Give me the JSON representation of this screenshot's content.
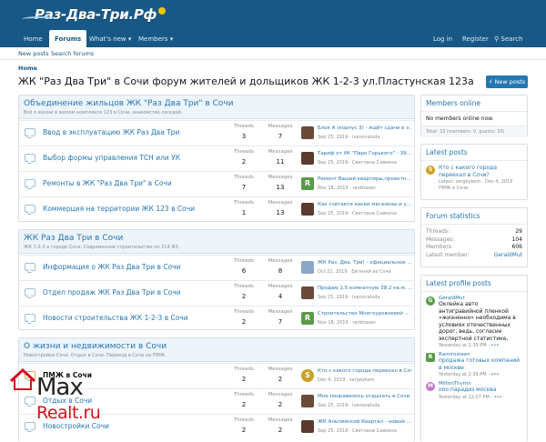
{
  "site": {
    "logo_text": "Раз-Два-Три.Рф"
  },
  "nav": {
    "home": "Home",
    "forums": "Forums",
    "whats_new": "What's new",
    "members": "Members",
    "login": "Log in",
    "register": "Register",
    "search": "Search"
  },
  "subnav": {
    "new_posts": "New posts",
    "search_forums": "Search forums"
  },
  "breadcrumb": "Home",
  "page_title": "ЖК \"Раз Два Три\" в Сочи форум жителей и дольщиков ЖК 1-2-3 ул.Пластунская 123а",
  "new_posts_button": "New posts",
  "stat_labels": {
    "threads": "Threads",
    "messages": "Messages"
  },
  "categories": [
    {
      "title": "Объединение жильцов ЖК \"Раз Два Три\" в Сочи",
      "desc": "Всё о жизни в жилом комплексе 123 в Сочи, знакомство соседей.",
      "forums": [
        {
          "name": "Ввод в эксплуатацию ЖК Раз Два Три",
          "threads": "3",
          "messages": "7",
          "last_title": "Блок А (корпус 3) - ждёт сдачи в э...",
          "last_meta": "Sep 25, 2019 · ivanovaluda",
          "avatar_letter": "",
          "avatar_color": "#6b4a3a"
        },
        {
          "name": "Выбор формы управления ТСН или УК",
          "threads": "2",
          "messages": "11",
          "last_title": "Тариф от УК \"Парк Горького\" - 39...",
          "last_meta": "Sep 25, 2019 · Светлана Савкина",
          "avatar_letter": "",
          "avatar_color": "#5a3a2e"
        },
        {
          "name": "Ремонты в ЖК \"Раз Два Три\" в Сочи",
          "threads": "7",
          "messages": "13",
          "last_title": "Ремонт Вашей квартиры,проектн...",
          "last_meta": "Nov 18, 2019 · rardroawn",
          "avatar_letter": "R",
          "avatar_color": "#5b9a4a"
        },
        {
          "name": "Коммерция на территории ЖК 123 в Сочи",
          "threads": "1",
          "messages": "13",
          "last_title": "Как считаете какие магазины и у...",
          "last_meta": "Sep 25, 2019 · Светлана Савкина",
          "avatar_letter": "",
          "avatar_color": "#5a3a2e"
        }
      ]
    },
    {
      "title": "ЖК Раз Два Три в Сочи",
      "desc": "ЖК 1-2-3 в городе Сочи. Современное строительство по 214 ФЗ.",
      "forums": [
        {
          "name": "Информация о ЖК Раз Два Три в Сочи",
          "threads": "6",
          "messages": "8",
          "last_title": "ЖК Раз. Два. Три! - официальное ...",
          "last_meta": "Oct 21, 2019 · Евгений из Сочи",
          "avatar_letter": "",
          "avatar_color": "#8aa6c8"
        },
        {
          "name": "Отдел продаж ЖК Раз Два Три в Сочи",
          "threads": "2",
          "messages": "4",
          "last_title": "Продаю 1,5 комнатную 38.2 кв.м. ...",
          "last_meta": "Sep 25, 2019 · ivanovaluda",
          "avatar_letter": "",
          "avatar_color": "#6b4a3a"
        },
        {
          "name": "Новости строительства ЖК 1-2-3 в Сочи",
          "threads": "2",
          "messages": "7",
          "last_title": "Строительство Многоуровневой ...",
          "last_meta": "Nov 18, 2019 · rardroawn",
          "avatar_letter": "R",
          "avatar_color": "#5b9a4a"
        }
      ]
    },
    {
      "title": "О жизни и недвижимости в Сочи",
      "desc": "Новостройки Сочи. Отдых в Сочи. Переезд в Сочи на ПМЖ.",
      "forums": [
        {
          "name": "ПМЖ в Сочи",
          "threads": "2",
          "messages": "2",
          "last_title": "Кто с какого города переехал в Сочи?",
          "last_meta": "Dec 4, 2019 · sergeykem",
          "avatar_letter": "S",
          "avatar_color": "#c9a227",
          "bold": true
        },
        {
          "name": "Отдых в Сочи",
          "threads": "2",
          "messages": "2",
          "last_title": "Мне понравилось отдыхать в Сочи",
          "last_meta": "Sep 25, 2019 · ivanovaluda",
          "avatar_letter": "",
          "avatar_color": "#6b4a3a"
        },
        {
          "name": "Новостройки Сочи",
          "threads": "2",
          "messages": "2",
          "last_title": "ЖК Альпийский Квартал - новый ...",
          "last_meta": "Sep 25, 2019 · Светлана Савкина",
          "avatar_letter": "",
          "avatar_color": "#5a3a2e"
        }
      ]
    }
  ],
  "sidebar": {
    "members_online": {
      "title": "Members online",
      "body": "No members online now.",
      "footer": "Total: 33 (members: 0, guests: 33)"
    },
    "latest_posts": {
      "title": "Latest posts",
      "post_title": "Кто с какого города переехал в Сочи?",
      "post_meta": "Latest: sergeykem · Dec 4, 2019",
      "post_forum": "ПМЖ в Сочи",
      "avatar_letter": "S",
      "avatar_color": "#c9a227"
    },
    "forum_stats": {
      "title": "Forum statistics",
      "rows": [
        {
          "label": "Threads:",
          "value": "29"
        },
        {
          "label": "Messages:",
          "value": "104"
        },
        {
          "label": "Members:",
          "value": "606"
        },
        {
          "label": "Latest member:",
          "value": "GeraldMut"
        }
      ]
    },
    "profile_posts": {
      "title": "Latest profile posts",
      "items": [
        {
          "name": "GeraldMut",
          "text": "Оклейка авто антигравийной пленкой «жизненно» необходима в условиях отечественных дорог, ведь, согласие экспертной статистике,",
          "meta": "Yesterday at 2:39 PM",
          "avatar_letter": "G",
          "avatar_color": "#5b9a4a"
        },
        {
          "name": "Ramirosteen",
          "text": "продажа готовых компаний в москве",
          "meta": "Yesterday at 2:39 PM",
          "avatar_letter": "R",
          "avatar_color": "#5b9a4a"
        },
        {
          "name": "MiltonThymn",
          "text": "ооо парадиз москва",
          "meta": "Yesterday at 12:07 PM",
          "avatar_letter": "M",
          "avatar_color": "#c279c9"
        }
      ]
    }
  },
  "watermark": {
    "line1": "Max",
    "line2": "Realt.ru"
  }
}
